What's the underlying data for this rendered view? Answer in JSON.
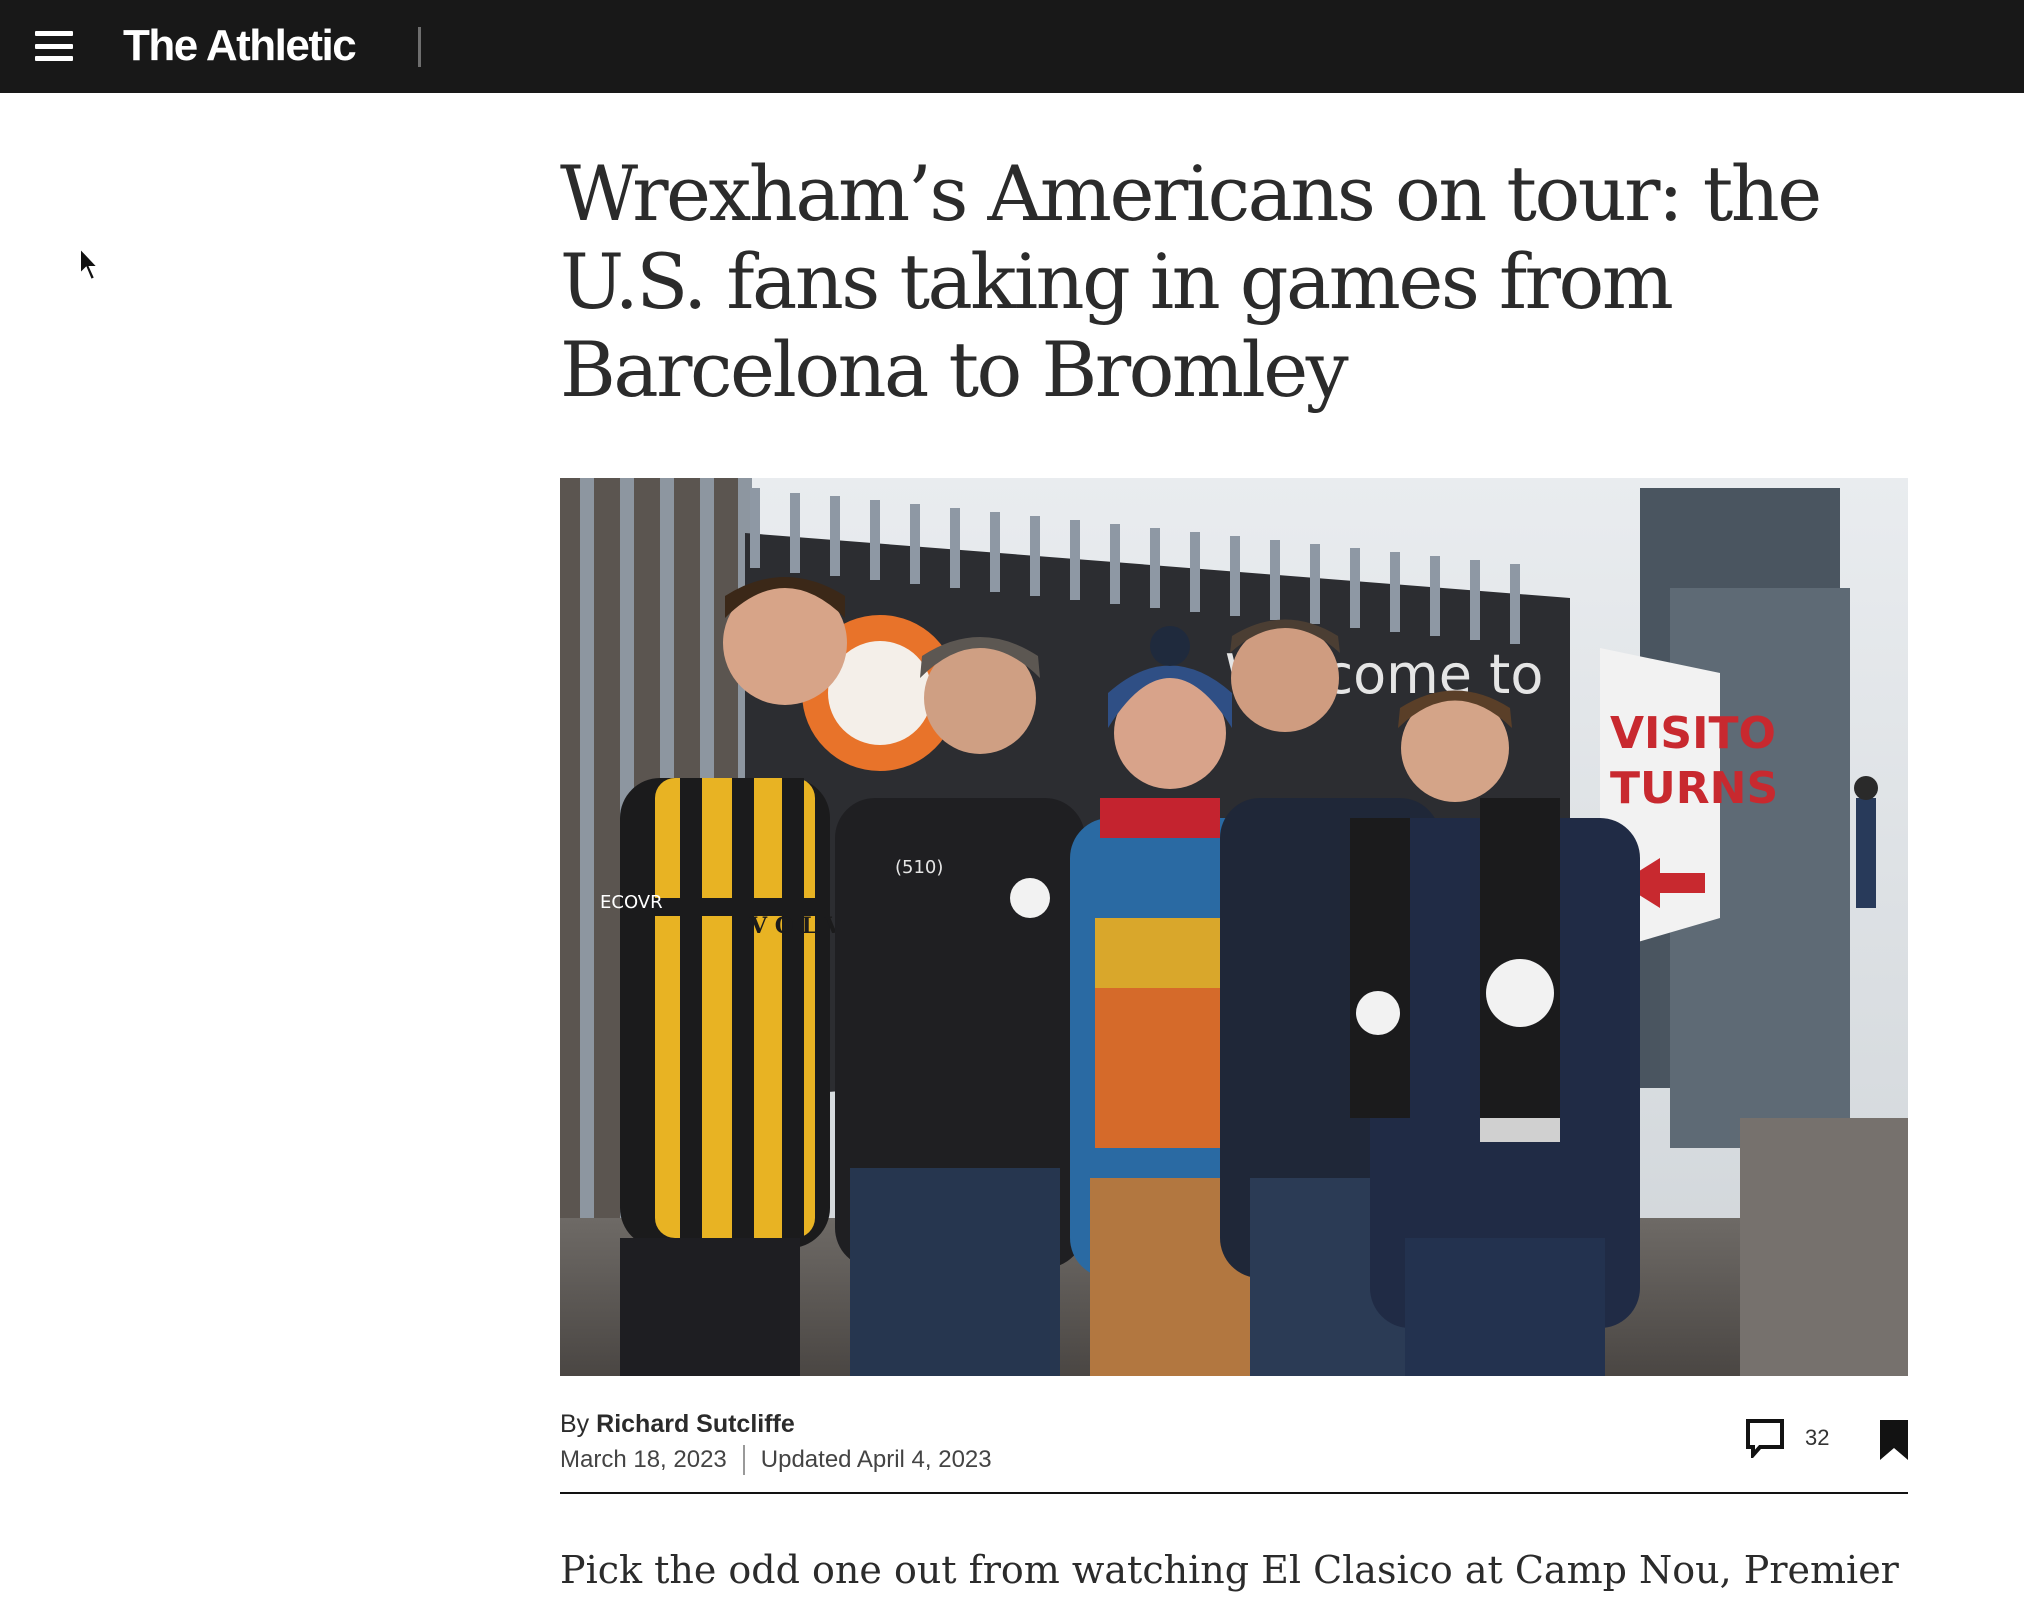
{
  "header": {
    "logo": "The Athletic",
    "menu_icon": "hamburger-menu-icon"
  },
  "article": {
    "headline": "Wrexham’s Americans on tour: the U.S. fans taking in games from Barcelona to Bromley",
    "image_alt": "Five men standing in front of a stadium wall and turnstile entrance",
    "byline_prefix": "By",
    "author": "Richard Sutcliffe",
    "published": "March 18, 2023",
    "updated": "Updated April 4, 2023",
    "comment_count": "32",
    "lede": "Pick the odd one out from watching El Clasico at Camp Nou, Premier"
  },
  "photo_text": {
    "sign_welcome": "Welcome to",
    "sign_visitors": "VISITO",
    "sign_turnstile": "TURNS",
    "shirt_sponsor": "V O L V",
    "jacket_badge": "(510)",
    "shirt_brand": "ECOVR"
  },
  "colors": {
    "topbar": "#181818",
    "accent_orange": "#e8732a",
    "text": "#2b2b2b"
  }
}
